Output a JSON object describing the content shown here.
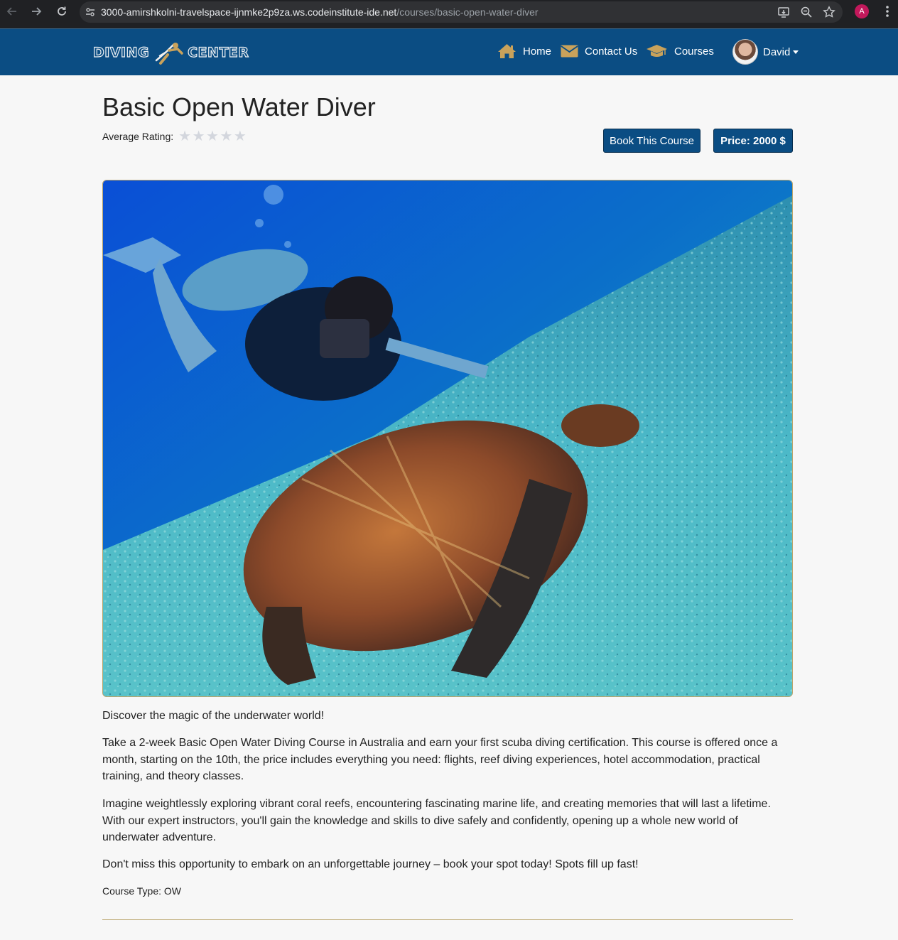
{
  "browser": {
    "url_host": "3000-amirshkolni-travelspace-ijnmke2p9za.ws.codeinstitute-ide.net",
    "url_path": "/courses/basic-open-water-diver",
    "profile_initial": "A"
  },
  "navbar": {
    "brand_left": "DIVING",
    "brand_right": "CENTER",
    "items": [
      {
        "label": "Home",
        "icon": "home-icon"
      },
      {
        "label": "Contact Us",
        "icon": "envelope-icon"
      },
      {
        "label": "Courses",
        "icon": "graduation-cap-icon"
      }
    ],
    "user": {
      "name": "David"
    },
    "colors": {
      "background": "#0b4d83",
      "icon": "#c9a25b"
    }
  },
  "course": {
    "title": "Basic Open Water Diver",
    "rating_label": "Average Rating:",
    "rating_value": 0,
    "rating_max": 5,
    "book_button": "Book This Course",
    "price_label": "Price: 2000 $",
    "image_alt": "Scuba diver photographing a sea turtle",
    "paragraphs": [
      "Discover the magic of the underwater world!",
      "Take a 2-week Basic Open Water Diving Course in Australia and  earn your first scuba diving certification.  This course is offered once a month, starting on the 10th, the price includes everything you need: flights, reef diving experiences,  hotel accommodation, practical training, and theory classes.",
      "Imagine weightlessly exploring vibrant coral reefs, encountering  fascinating marine life, and creating memories that will last a  lifetime. With our expert instructors, you'll gain the knowledge and  skills to dive safely and confidently, opening up a whole new world of  underwater adventure.",
      "Don't miss this opportunity to embark on an unforgettable journey  – book your spot today! Spots fill up fast!"
    ],
    "course_type": "Course Type: OW"
  }
}
